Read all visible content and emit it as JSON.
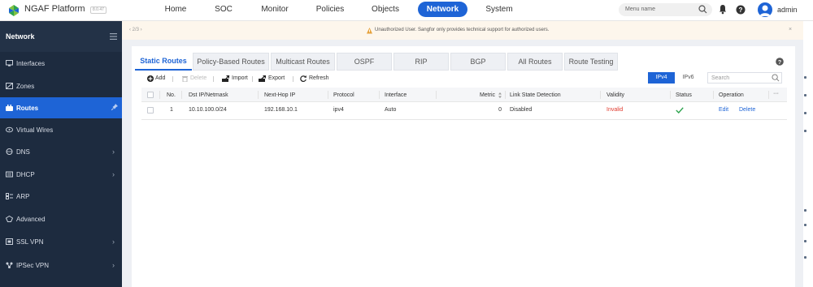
{
  "app": {
    "title": "NGAF Platform",
    "version": "8.0.47"
  },
  "topnav": {
    "items": [
      {
        "label": "Home",
        "active": false
      },
      {
        "label": "SOC",
        "active": false
      },
      {
        "label": "Monitor",
        "active": false
      },
      {
        "label": "Policies",
        "active": false
      },
      {
        "label": "Objects",
        "active": false
      },
      {
        "label": "Network",
        "active": true
      },
      {
        "label": "System",
        "active": false
      }
    ],
    "menu_search_placeholder": "Menu name",
    "user": "admin"
  },
  "sidebar": {
    "title": "Network",
    "items": [
      {
        "label": "Interfaces",
        "icon": "monitor-icon",
        "has_children": false,
        "active": false
      },
      {
        "label": "Zones",
        "icon": "zone-icon",
        "has_children": false,
        "active": false
      },
      {
        "label": "Routes",
        "icon": "routes-icon",
        "has_children": false,
        "active": true
      },
      {
        "label": "Virtual Wires",
        "icon": "virtual-wire-icon",
        "has_children": false,
        "active": false
      },
      {
        "label": "DNS",
        "icon": "dns-icon",
        "has_children": true,
        "active": false
      },
      {
        "label": "DHCP",
        "icon": "dhcp-icon",
        "has_children": true,
        "active": false
      },
      {
        "label": "ARP",
        "icon": "arp-icon",
        "has_children": false,
        "active": false
      },
      {
        "label": "Advanced",
        "icon": "advanced-icon",
        "has_children": false,
        "active": false
      },
      {
        "label": "SSL VPN",
        "icon": "ssl-vpn-icon",
        "has_children": true,
        "active": false
      },
      {
        "label": "IPSec VPN",
        "icon": "ipsec-vpn-icon",
        "has_children": true,
        "active": false
      }
    ]
  },
  "notice": {
    "pager": "‹  2/3  ›",
    "text": "Unauthorized User. Sangfor only provides technical support for authorized users.",
    "close": "×"
  },
  "tabs": [
    {
      "label": "Static Routes",
      "active": true
    },
    {
      "label": "Policy-Based Routes",
      "active": false
    },
    {
      "label": "Multicast Routes",
      "active": false
    },
    {
      "label": "OSPF",
      "active": false
    },
    {
      "label": "RIP",
      "active": false
    },
    {
      "label": "BGP",
      "active": false
    },
    {
      "label": "All Routes",
      "active": false
    },
    {
      "label": "Route Testing",
      "active": false
    }
  ],
  "toolbar": {
    "add": "Add",
    "delete": "Delete",
    "import": "Import",
    "export": "Export",
    "refresh": "Refresh",
    "ipv4": "IPv4",
    "ipv6": "IPv6",
    "search_placeholder": "Search"
  },
  "table": {
    "columns": {
      "no": "No.",
      "dst": "Dst IP/Netmask",
      "nexthop": "Next-Hop IP",
      "protocol": "Protocol",
      "interface": "Interface",
      "metric": "Metric",
      "link_state": "Link State Detection",
      "validity": "Validity",
      "status": "Status",
      "operation": "Operation",
      "more": "···"
    },
    "rows": [
      {
        "no": "1",
        "dst": "10.10.100.0/24",
        "nexthop": "192.168.10.1",
        "protocol": "ipv4",
        "interface": "Auto",
        "metric": "0",
        "link_state": "Disabled",
        "validity": "Invalid",
        "status_icon": "check-icon",
        "edit": "Edit",
        "delete": "Delete"
      }
    ]
  },
  "colors": {
    "accent": "#1e64d6",
    "sidebar": "#1d2b3f",
    "invalid": "#e03a2e",
    "valid": "#2ea44f",
    "notice_bg": "#fdf6ec"
  }
}
